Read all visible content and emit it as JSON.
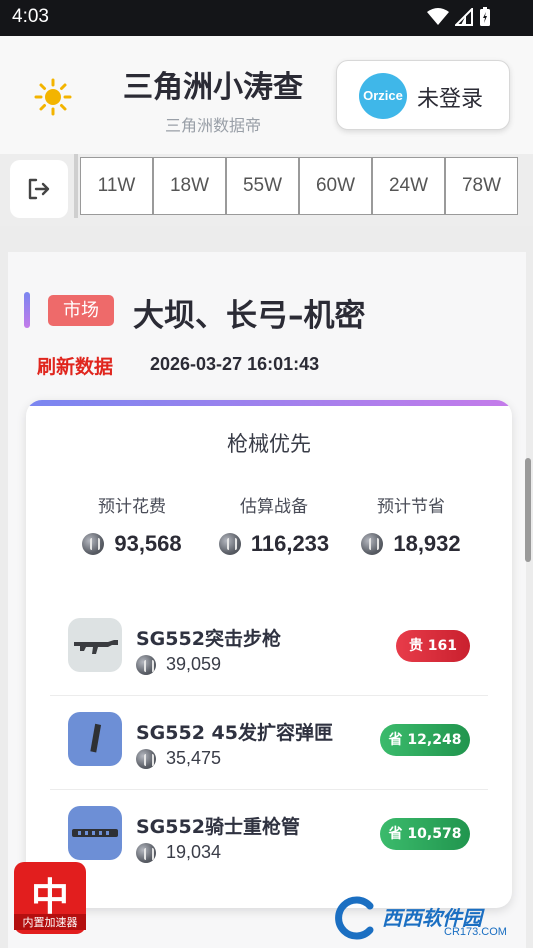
{
  "status_bar": {
    "time": "4:03"
  },
  "header": {
    "title": "三角洲小涛查",
    "subtitle": "三角洲数据帝",
    "login_logo": "Orzice",
    "login_label": "未登录"
  },
  "tabs": [
    "11W",
    "18W",
    "55W",
    "60W",
    "24W",
    "78W"
  ],
  "section": {
    "badge": "市场",
    "map_name": "大坝、长弓–机密",
    "refresh_label": "刷新数据",
    "refresh_time": "2026-03-27 16:01:43"
  },
  "card": {
    "title": "枪械优先",
    "stats": [
      {
        "label": "预计花费",
        "value": "93,568"
      },
      {
        "label": "估算战备",
        "value": "116,233"
      },
      {
        "label": "预计节省",
        "value": "18,932"
      }
    ],
    "items": [
      {
        "name": "SG552突击步枪",
        "price": "39,059",
        "tag": "贵 161",
        "tag_type": "expensive",
        "icon": "rifle-icon"
      },
      {
        "name": "SG552 45发扩容弹匣",
        "price": "35,475",
        "tag": "省 12,248",
        "tag_type": "saving",
        "icon": "magazine-icon"
      },
      {
        "name": "SG552骑士重枪管",
        "price": "19,034",
        "tag": "省 10,578",
        "tag_type": "saving",
        "icon": "barrel-icon"
      }
    ]
  },
  "watermarks": {
    "left_big": "中",
    "left_small": "内置加速器",
    "right_text": "西西软件园",
    "right_domain": "CR173.COM"
  },
  "colors": {
    "accent_red": "#e0261e",
    "badge_red": "#ee6a6a",
    "saving_green": "#21954e",
    "expensive_red": "#c9202e",
    "gradient_start": "#7a86f0",
    "gradient_end": "#c47bea"
  }
}
